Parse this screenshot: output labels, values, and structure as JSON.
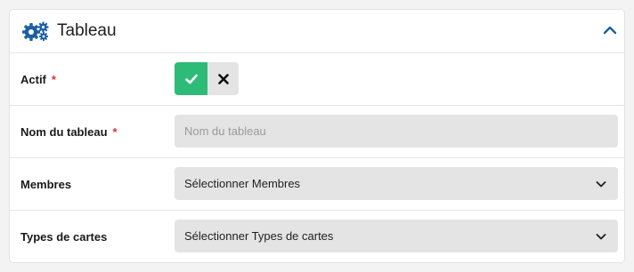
{
  "panel": {
    "title": "Tableau",
    "header_icon": "gears-icon",
    "collapse_icon": "chevron-up-icon",
    "accent_color": "#1b5fa6"
  },
  "fields": {
    "actif": {
      "label": "Actif",
      "required_mark": "*",
      "value": true,
      "yes_icon": "check-icon",
      "no_icon": "x-icon",
      "yes_color": "#2dbc78"
    },
    "nom": {
      "label": "Nom du tableau",
      "required_mark": "*",
      "value": "",
      "placeholder": "Nom du tableau"
    },
    "membres": {
      "label": "Membres",
      "selected": "Sélectionner Membres"
    },
    "types": {
      "label": "Types de cartes",
      "selected": "Sélectionner Types de cartes"
    }
  }
}
